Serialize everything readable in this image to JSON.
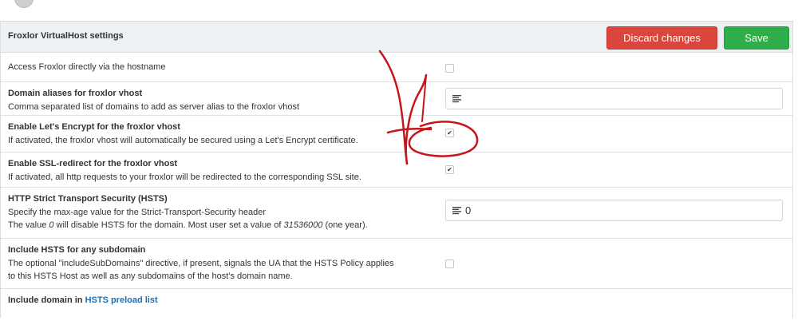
{
  "panel": {
    "title": "Froxlor VirtualHost settings",
    "discard_label": "Discard changes",
    "save_label": "Save"
  },
  "settings": [
    {
      "type": "checkbox",
      "title": "",
      "plain": "Access Froxlor directly via the hostname",
      "desc": [],
      "checked": false
    },
    {
      "type": "text",
      "title": "Domain aliases for froxlor vhost",
      "desc": [
        "Comma separated list of domains to add as server alias to the froxlor vhost"
      ],
      "value": ""
    },
    {
      "type": "checkbox",
      "title": "Enable Let's Encrypt for the froxlor vhost",
      "desc": [
        "If activated, the froxlor vhost will automatically be secured using a Let's Encrypt certificate."
      ],
      "checked": true
    },
    {
      "type": "checkbox",
      "title": "Enable SSL-redirect for the froxlor vhost",
      "desc": [
        "If activated, all http requests to your froxlor will be redirected to the corresponding SSL site."
      ],
      "checked": true
    },
    {
      "type": "text",
      "title": "HTTP Strict Transport Security (HSTS)",
      "desc": [
        "Specify the max-age value for the Strict-Transport-Security header"
      ],
      "desc2_prefix": "The value ",
      "desc2_italic": "0",
      "desc2_mid": " will disable HSTS for the domain. Most user set a value of ",
      "desc2_italic2": "31536000",
      "desc2_suffix": " (one year).",
      "value": "0"
    },
    {
      "type": "checkbox",
      "title": "Include HSTS for any subdomain",
      "desc": [
        "The optional \"includeSubDomains\" directive, if present, signals the UA that the HSTS Policy applies",
        "to this HSTS Host as well as any subdomains of the host's domain name."
      ],
      "checked": false
    },
    {
      "type": "checkbox",
      "title_prefix": "Include domain in ",
      "title_link": "HSTS preload list",
      "desc": []
    }
  ],
  "icons": {
    "list": "list-icon",
    "check": "check-icon"
  },
  "colors": {
    "discard": "#d9463b",
    "save": "#2fad48",
    "annotation": "#c4161c",
    "link": "#1e6fb6"
  }
}
